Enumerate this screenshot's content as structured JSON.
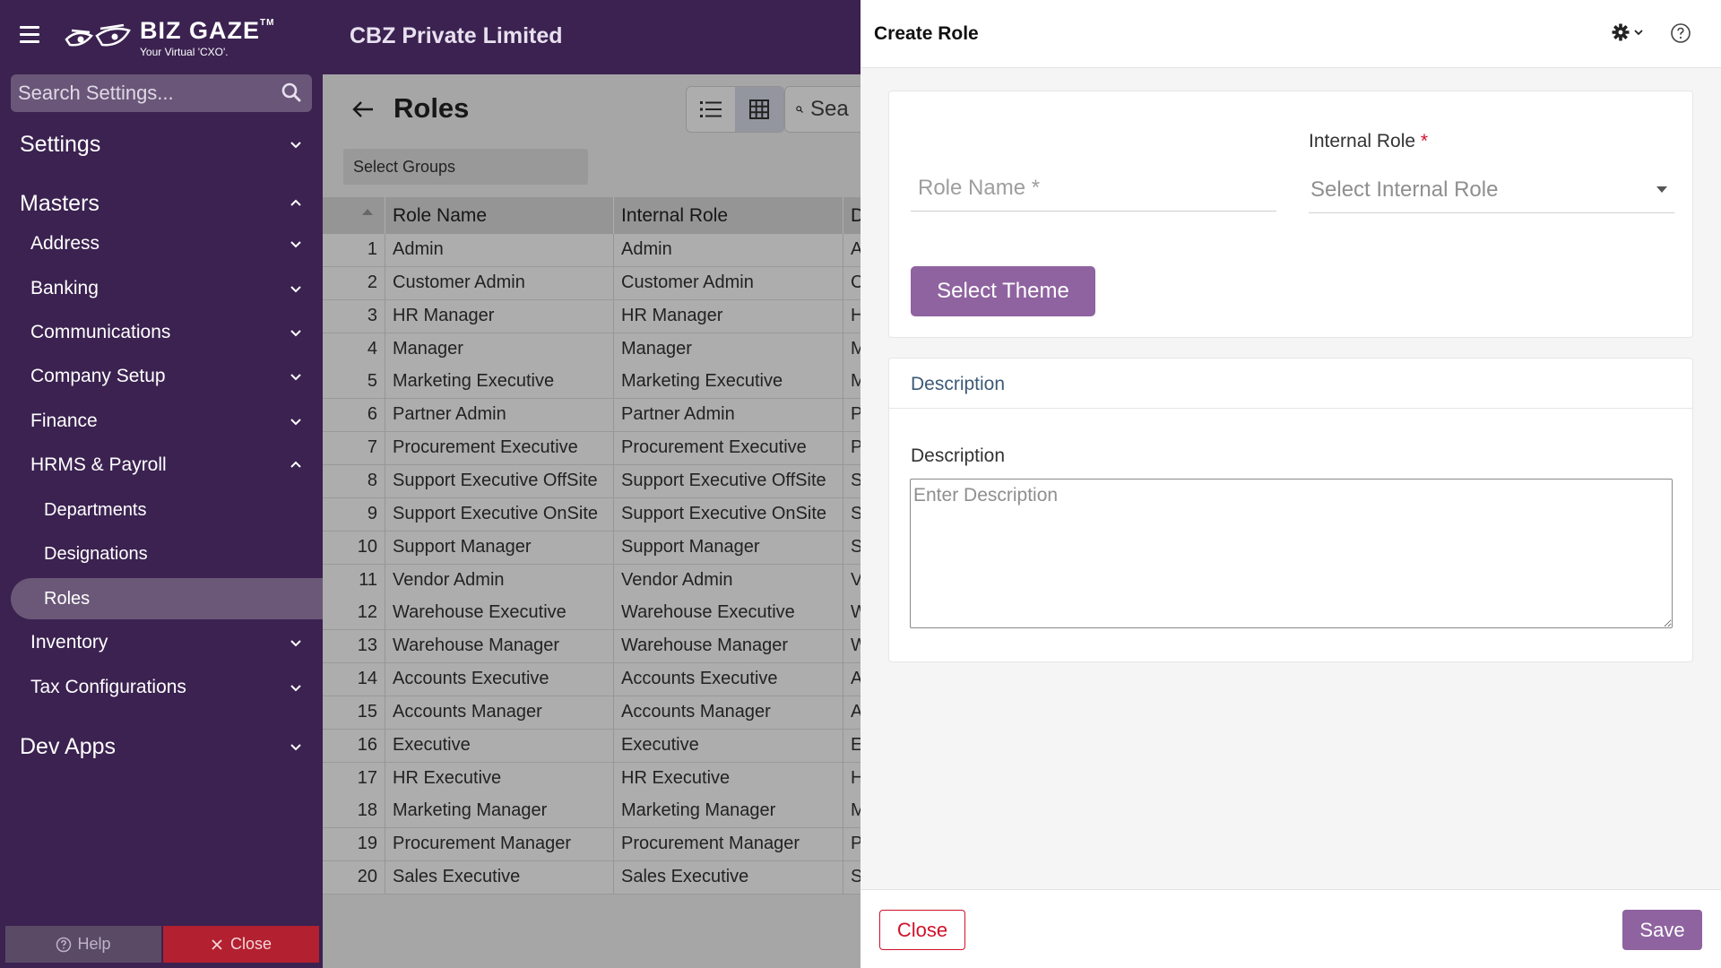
{
  "header": {
    "brand_name": "BIZ GAZE",
    "brand_tm": "TM",
    "brand_tagline": "Your Virtual 'CXO'.",
    "company": "CBZ Private Limited"
  },
  "sidebar": {
    "search_placeholder": "Search Settings...",
    "items": [
      {
        "label": "Settings",
        "level": 0,
        "state": "collapsed"
      },
      {
        "label": "Masters",
        "level": 0,
        "state": "expanded"
      },
      {
        "label": "Address",
        "level": 1,
        "state": "collapsed"
      },
      {
        "label": "Banking",
        "level": 1,
        "state": "collapsed"
      },
      {
        "label": "Communications",
        "level": 1,
        "state": "collapsed"
      },
      {
        "label": "Company Setup",
        "level": 1,
        "state": "collapsed"
      },
      {
        "label": "Finance",
        "level": 1,
        "state": "collapsed"
      },
      {
        "label": "HRMS & Payroll",
        "level": 1,
        "state": "expanded"
      },
      {
        "label": "Departments",
        "level": 2
      },
      {
        "label": "Designations",
        "level": 2
      },
      {
        "label": "Roles",
        "level": 2,
        "active": true
      },
      {
        "label": "Inventory",
        "level": 1,
        "state": "collapsed"
      },
      {
        "label": "Tax Configurations",
        "level": 1,
        "state": "collapsed"
      },
      {
        "label": "Dev Apps",
        "level": 0,
        "state": "collapsed"
      }
    ],
    "help_label": "Help",
    "close_label": "Close"
  },
  "main": {
    "title": "Roles",
    "search_placeholder": "Sea",
    "select_groups": "Select Groups",
    "columns": [
      "Role Name",
      "Internal Role",
      "D"
    ],
    "rows": [
      {
        "n": "1",
        "role": "Admin",
        "internal": "Admin",
        "d": "A"
      },
      {
        "n": "2",
        "role": "Customer Admin",
        "internal": "Customer Admin",
        "d": "C"
      },
      {
        "n": "3",
        "role": "HR Manager",
        "internal": "HR Manager",
        "d": "H"
      },
      {
        "n": "4",
        "role": "Manager",
        "internal": "Manager",
        "d": "M"
      },
      {
        "n": "5",
        "role": "Marketing Executive",
        "internal": "Marketing Executive",
        "d": "M"
      },
      {
        "n": "6",
        "role": "Partner Admin",
        "internal": "Partner Admin",
        "d": "P"
      },
      {
        "n": "7",
        "role": "Procurement Executive",
        "internal": "Procurement Executive",
        "d": "P"
      },
      {
        "n": "8",
        "role": "Support Executive OffSite",
        "internal": "Support Executive OffSite",
        "d": "S"
      },
      {
        "n": "9",
        "role": "Support Executive OnSite",
        "internal": "Support Executive OnSite",
        "d": "S"
      },
      {
        "n": "10",
        "role": "Support Manager",
        "internal": "Support Manager",
        "d": "S"
      },
      {
        "n": "11",
        "role": "Vendor Admin",
        "internal": "Vendor Admin",
        "d": "V"
      },
      {
        "n": "12",
        "role": "Warehouse Executive",
        "internal": "Warehouse Executive",
        "d": "W"
      },
      {
        "n": "13",
        "role": "Warehouse Manager",
        "internal": "Warehouse Manager",
        "d": "W"
      },
      {
        "n": "14",
        "role": "Accounts Executive",
        "internal": "Accounts Executive",
        "d": "A"
      },
      {
        "n": "15",
        "role": "Accounts Manager",
        "internal": "Accounts Manager",
        "d": "A"
      },
      {
        "n": "16",
        "role": "Executive",
        "internal": "Executive",
        "d": "E"
      },
      {
        "n": "17",
        "role": "HR Executive",
        "internal": "HR Executive",
        "d": "H"
      },
      {
        "n": "18",
        "role": "Marketing Manager",
        "internal": "Marketing Manager",
        "d": "M"
      },
      {
        "n": "19",
        "role": "Procurement Manager",
        "internal": "Procurement Manager",
        "d": "P"
      },
      {
        "n": "20",
        "role": "Sales Executive",
        "internal": "Sales Executive",
        "d": "S"
      }
    ]
  },
  "panel": {
    "title": "Create Role",
    "role_name_placeholder": "Role Name *",
    "role_name_value": "",
    "internal_role_label": "Internal Role",
    "required_mark": "*",
    "internal_role_placeholder": "Select Internal Role",
    "select_theme_label": "Select Theme",
    "description_section": "Description",
    "description_label": "Description",
    "description_placeholder": "Enter Description",
    "close_label": "Close",
    "save_label": "Save"
  },
  "colors": {
    "brand_dark": "#3b2250",
    "accent": "#8f63a0",
    "danger": "#d0112b"
  }
}
